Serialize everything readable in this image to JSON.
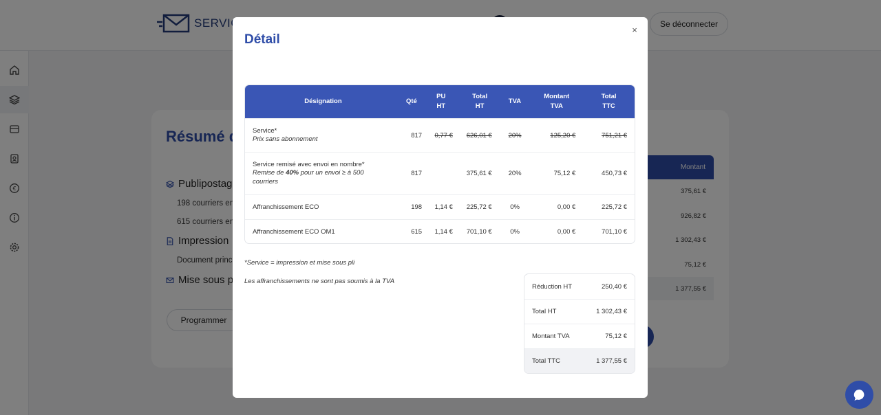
{
  "background": {
    "logo_text": "SERVICE",
    "logout_label": "Se déconnecter",
    "title": "Résumé d",
    "sections": [
      {
        "label": "Publipostag",
        "icon": "layers-icon"
      },
      {
        "label": "Impression",
        "icon": "document-icon"
      },
      {
        "label": "Mise sous pl",
        "icon": "envelope-icon"
      }
    ],
    "lines": [
      "198 courriers en",
      "615 courriers en",
      "Document princ"
    ],
    "schedule_label": "Programmer",
    "amount_header": "Montant",
    "amounts": [
      "375,61 €",
      "926,82 €",
      "1 302,43 €",
      "75,12 €",
      "1 377,55 €"
    ]
  },
  "sidebar": {
    "icons": [
      "home-icon",
      "layers-icon",
      "inbox-icon",
      "contacts-icon",
      "euro-icon",
      "info-icon",
      "gear-icon"
    ]
  },
  "modal": {
    "title": "Détail",
    "close_symbol": "×",
    "headers": {
      "designation": "Désignation",
      "qte": "Qté",
      "pu": "PU HT",
      "total_ht": "Total HT",
      "tva": "TVA",
      "montant_tva": "Montant TVA",
      "total_ttc": "Total TTC"
    },
    "rows": [
      {
        "label": "Service*",
        "sub": "Prix sans abonnement",
        "qte": "817",
        "pu": "0,77 €",
        "total_ht": "626,01 €",
        "tva": "20%",
        "montant_tva": "125,20 €",
        "total_ttc": "751,21 €",
        "strikethrough": true
      },
      {
        "label": "Service remisé avec envoi en nombre*",
        "sub_before": "Remise de ",
        "sub_bold": "40%",
        "sub_after": " pour un envoi ≥ à 500 courriers",
        "qte": "817",
        "pu": "",
        "total_ht": "375,61 €",
        "tva": "20%",
        "montant_tva": "75,12 €",
        "total_ttc": "450,73 €"
      },
      {
        "label": "Affranchissement ECO",
        "qte": "198",
        "pu": "1,14 €",
        "total_ht": "225,72 €",
        "tva": "0%",
        "montant_tva": "0,00 €",
        "total_ttc": "225,72 €"
      },
      {
        "label": "Affranchissement ECO OM1",
        "qte": "615",
        "pu": "1,14 €",
        "total_ht": "701,10 €",
        "tva": "0%",
        "montant_tva": "0,00 €",
        "total_ttc": "701,10 €"
      }
    ],
    "note_service": "*Service = impression et mise sous pli",
    "note_tva": "Les affranchissements ne sont pas soumis à la TVA",
    "summary": [
      {
        "label": "Réduction HT",
        "value": "250,40 €"
      },
      {
        "label": "Total HT",
        "value": "1 302,43 €"
      },
      {
        "label": "Montant TVA",
        "value": "75,12 €"
      },
      {
        "label": "Total TTC",
        "value": "1 377,55 €"
      }
    ]
  },
  "colors": {
    "accent": "#2f4da8",
    "table_header": "#3a56b5",
    "overlay": "rgba(0,0,0,0.5)"
  }
}
